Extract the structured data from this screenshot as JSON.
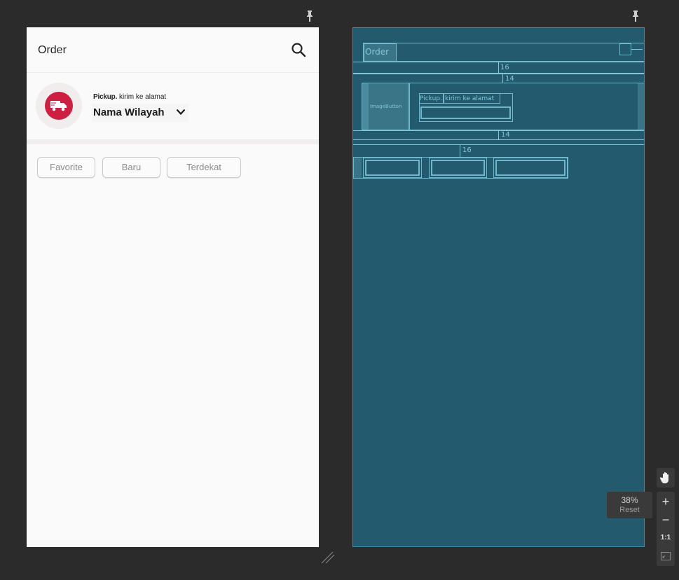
{
  "design": {
    "toolbar": {
      "title": "Order"
    },
    "pickup": {
      "label_bold": "Pickup.",
      "label_rest": "kirim ke alamat",
      "region_name": "Nama Wilayah"
    },
    "chips": [
      "Favorite",
      "Baru",
      "Terdekat"
    ],
    "colors": {
      "accent": "#cc1f41",
      "background": "#fafafa"
    }
  },
  "blueprint": {
    "toolbar_title": "Order",
    "image_button_label": "ImageButton",
    "pickup_label": "Pickup.",
    "kirim_label": "kirim ke alamat",
    "margin_16_top": "16",
    "margin_14_top": "14",
    "margin_14_bottom": "14",
    "margin_16_chips": "16"
  },
  "zoom": {
    "level": "38%",
    "reset_label": "Reset",
    "one_to_one": "1:1"
  },
  "icons": [
    "pin-icon",
    "search-icon",
    "truck-icon",
    "chevron-down-icon",
    "hand-icon",
    "plus-icon",
    "minus-icon",
    "fit-screen-icon",
    "resize-handle-icon"
  ]
}
